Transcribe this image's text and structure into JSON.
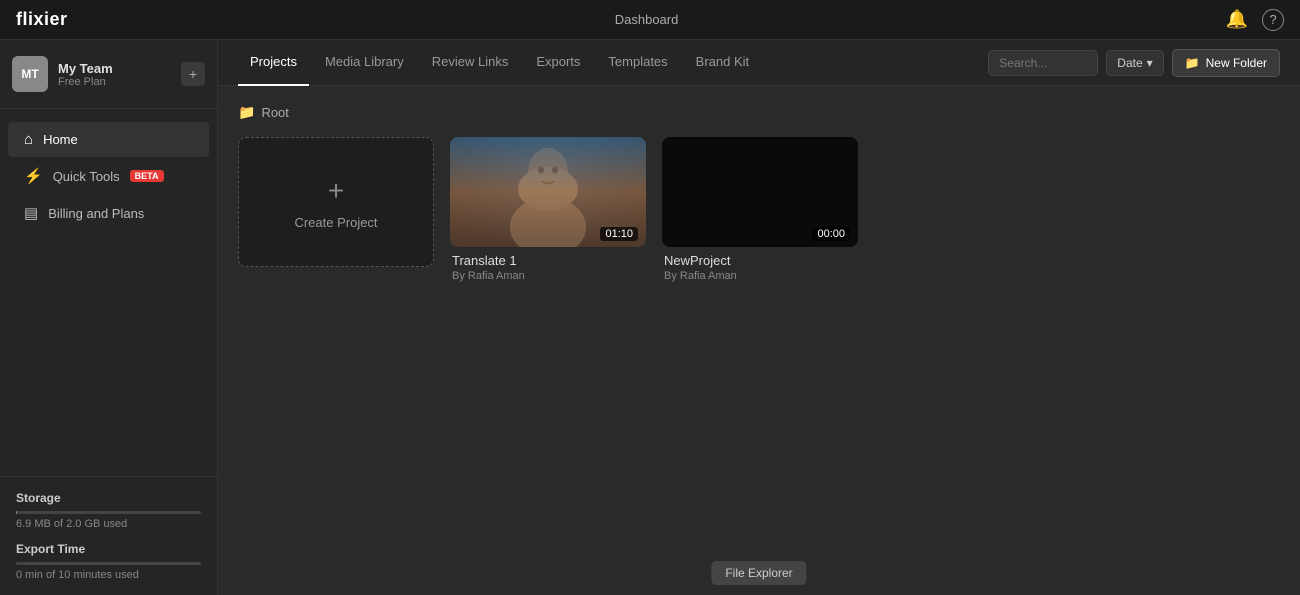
{
  "app": {
    "logo": "flixier",
    "topbar_center": "Dashboard",
    "notification_icon": "🔔",
    "help_icon": "?"
  },
  "sidebar": {
    "team": {
      "avatar_text": "MT",
      "name": "My Team",
      "plan": "Free Plan",
      "settings_icon": "+"
    },
    "nav": [
      {
        "id": "home",
        "icon": "⌂",
        "label": "Home",
        "active": true
      },
      {
        "id": "quick-tools",
        "icon": "⚡",
        "label": "Quick Tools",
        "badge": "beta"
      },
      {
        "id": "billing",
        "icon": "▤",
        "label": "Billing and Plans"
      }
    ],
    "storage": {
      "label": "Storage",
      "used_text": "6.9 MB of 2.0 GB used",
      "percent": 0.4
    },
    "export": {
      "label": "Export Time",
      "used_text": "0 min of 10 minutes used",
      "percent": 0
    }
  },
  "tabs": [
    {
      "id": "projects",
      "label": "Projects",
      "active": true
    },
    {
      "id": "media-library",
      "label": "Media Library"
    },
    {
      "id": "review-links",
      "label": "Review Links"
    },
    {
      "id": "exports",
      "label": "Exports"
    },
    {
      "id": "templates",
      "label": "Templates"
    },
    {
      "id": "brand-kit",
      "label": "Brand Kit"
    }
  ],
  "toolbar": {
    "search_placeholder": "Search...",
    "date_label": "Date",
    "new_folder_label": "New Folder",
    "folder_icon": "📁"
  },
  "breadcrumb": {
    "icon": "📁",
    "path": "Root"
  },
  "projects": [
    {
      "id": "create",
      "type": "create",
      "label": "Create Project"
    },
    {
      "id": "translate1",
      "type": "video",
      "title": "Translate 1",
      "author": "By Rafia Aman",
      "duration": "01:10",
      "has_content": true
    },
    {
      "id": "newproject",
      "type": "video",
      "title": "NewProject",
      "author": "By Rafia Aman",
      "duration": "00:00",
      "has_content": false
    }
  ],
  "file_explorer_label": "File Explorer"
}
